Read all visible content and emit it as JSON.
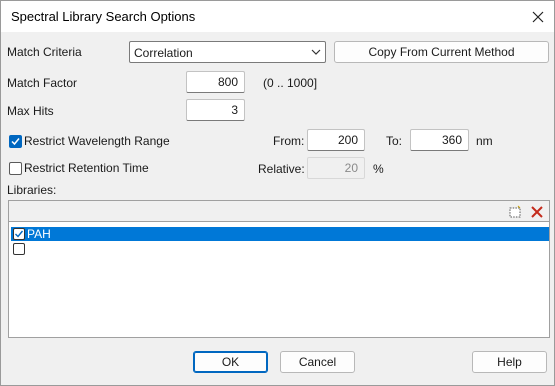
{
  "window": {
    "title": "Spectral Library Search Options"
  },
  "match_criteria": {
    "label": "Match Criteria",
    "value": "Correlation"
  },
  "copy_button": {
    "label": "Copy From Current Method"
  },
  "match_factor": {
    "label": "Match Factor",
    "value": "800",
    "range": "(0 .. 1000]"
  },
  "max_hits": {
    "label": "Max Hits",
    "value": "3"
  },
  "restrict_wavelength": {
    "label": "Restrict Wavelength Range",
    "checked": true,
    "from_label": "From:",
    "from_value": "200",
    "to_label": "To:",
    "to_value": "360",
    "unit": "nm"
  },
  "restrict_retention": {
    "label": "Restrict Retention Time",
    "checked": false,
    "relative_label": "Relative:",
    "relative_value": "20",
    "unit": "%"
  },
  "libraries": {
    "label": "Libraries:",
    "items": [
      {
        "name": "PAH",
        "checked": true,
        "selected": true
      },
      {
        "name": "",
        "checked": false,
        "selected": false
      }
    ]
  },
  "buttons": {
    "ok": "OK",
    "cancel": "Cancel",
    "help": "Help"
  },
  "colors": {
    "accent": "#0067c0",
    "selection": "#0078d7",
    "delete_icon": "#c42b1c"
  }
}
